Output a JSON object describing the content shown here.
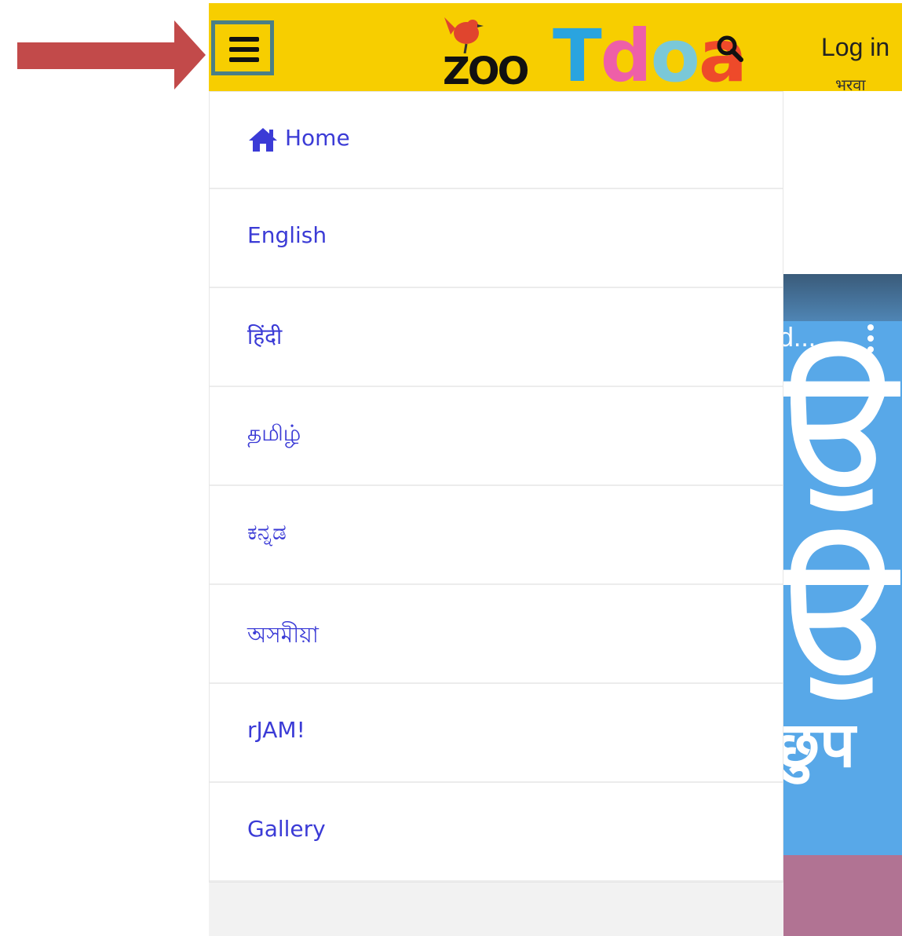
{
  "header": {
    "logo_text_zoo": "ZOO",
    "logo_text_main": "Tdoa",
    "login_label": "Log in",
    "lang_subtitle": "भरवा",
    "icons": [
      "menu-icon",
      "search-icon"
    ]
  },
  "menu": {
    "items": [
      {
        "label": "Home",
        "icon": "home-icon"
      },
      {
        "label": "English"
      },
      {
        "label": "हिंदी"
      },
      {
        "label": "தமிழ்"
      },
      {
        "label": "ಕನ್ನಡ"
      },
      {
        "label": "অসমীয়া"
      },
      {
        "label": "rJAM!"
      },
      {
        "label": "Gallery"
      }
    ]
  },
  "background": {
    "video_title_fragment": "d...",
    "glyph_text": "छुप"
  },
  "colors": {
    "header_bg": "#f7ce00",
    "link": "#3b3bd6",
    "annotation_arrow": "#c24a4a",
    "annotation_box": "#4a7f86",
    "video_bg": "#58a8e8"
  }
}
